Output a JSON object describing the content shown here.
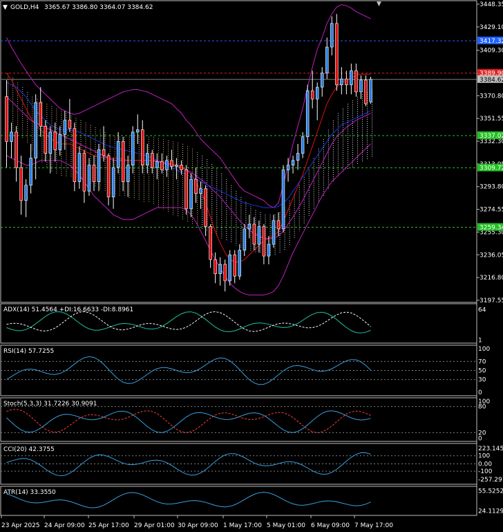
{
  "colors": {
    "background": "#000000",
    "frame": "#c0c0c0",
    "bull": "#2a7de1",
    "bear": "#e01010",
    "bb": "#c020c0",
    "ma_red": "#e01010",
    "ma_blue": "#1a35d8",
    "chikou": "#28c828",
    "kumo_bull": "#d8c090",
    "kumo_bear": "#e8e8e8",
    "level_green": "#22c022",
    "level_red": "#e02020",
    "level_blue": "#2060ff",
    "indicator_line": "#3aa0e0",
    "indicator_signal": "#ff4040",
    "adx_plus": "#20c0a0"
  },
  "header": {
    "symbol_label": "GOLD,H4",
    "ohlc": "3365.67 3386.80 3364.07 3384.62",
    "arrow_icon": "triangle-down-icon"
  },
  "price_axis": {
    "ticks": [
      "3448.35",
      "3429.10",
      "3409.30",
      "3389.61",
      "3370.80",
      "3351.55",
      "3332.30",
      "3313.05",
      "3293.80",
      "3274.55",
      "3255.30",
      "3236.05",
      "3216.80",
      "3197.55"
    ],
    "tags": [
      {
        "text": "3417.32",
        "color": "#2060ff",
        "value": 3417.32
      },
      {
        "text": "3389.90",
        "color": "#e02020",
        "value": 3389.9
      },
      {
        "text": "3384.62",
        "color": "#c0c0c0",
        "value": 3384.62
      },
      {
        "text": "3337.02",
        "color": "#22c022",
        "value": 3337.02
      },
      {
        "text": "3309.72",
        "color": "#22c022",
        "value": 3309.72
      },
      {
        "text": "3259.34",
        "color": "#22c022",
        "value": 3259.34
      }
    ]
  },
  "time_axis": [
    "23 Apr 2025",
    "24 Apr 09:00",
    "25 Apr 17:00",
    "29 Apr 01:00",
    "30 Apr 09:00",
    "1 May 17:00",
    "5 May 01:00",
    "6 May 09:00",
    "7 May 17:00"
  ],
  "panels": {
    "adx": {
      "label": "ADX(14) 51.4564 +DI:16.6633 -DI:8.8961",
      "ticks": [
        "64",
        "1"
      ]
    },
    "rsi": {
      "label": "RSI(14) 57.7255",
      "ticks": [
        "100",
        "70",
        "50",
        "30",
        "0"
      ]
    },
    "stoch": {
      "label": "Stoch(5,3,3) 31.7226 30.9091",
      "ticks": [
        "100",
        "80",
        "20",
        "0"
      ]
    },
    "cci": {
      "label": "CCI(20) 42.3755",
      "ticks": [
        "223.1458",
        "100",
        "0.00",
        "-100",
        "-257.297"
      ]
    },
    "atr": {
      "label": "ATR(14) 33.3550",
      "ticks": [
        "55.5252",
        "24.1129"
      ]
    }
  },
  "chart_data": {
    "type": "candlestick",
    "symbol": "GOLD",
    "timeframe": "H4",
    "ylim": [
      3197.55,
      3448.35
    ],
    "candles": [
      [
        3370,
        3384,
        3310,
        3332
      ],
      [
        3332,
        3348,
        3318,
        3340
      ],
      [
        3340,
        3345,
        3298,
        3310
      ],
      [
        3310,
        3320,
        3270,
        3282
      ],
      [
        3282,
        3300,
        3268,
        3295
      ],
      [
        3295,
        3330,
        3288,
        3318
      ],
      [
        3318,
        3372,
        3300,
        3365
      ],
      [
        3365,
        3378,
        3336,
        3345
      ],
      [
        3345,
        3350,
        3315,
        3322
      ],
      [
        3322,
        3345,
        3305,
        3340
      ],
      [
        3340,
        3348,
        3315,
        3325
      ],
      [
        3325,
        3345,
        3320,
        3338
      ],
      [
        3338,
        3358,
        3325,
        3350
      ],
      [
        3350,
        3368,
        3340,
        3343
      ],
      [
        3343,
        3348,
        3290,
        3298
      ],
      [
        3298,
        3328,
        3292,
        3322
      ],
      [
        3322,
        3325,
        3280,
        3290
      ],
      [
        3290,
        3318,
        3286,
        3312
      ],
      [
        3312,
        3320,
        3290,
        3298
      ],
      [
        3298,
        3330,
        3290,
        3325
      ],
      [
        3325,
        3345,
        3315,
        3320
      ],
      [
        3320,
        3322,
        3278,
        3285
      ],
      [
        3285,
        3318,
        3275,
        3310
      ],
      [
        3310,
        3340,
        3305,
        3332
      ],
      [
        3332,
        3336,
        3290,
        3298
      ],
      [
        3298,
        3320,
        3285,
        3312
      ],
      [
        3312,
        3345,
        3305,
        3340
      ],
      [
        3340,
        3355,
        3330,
        3342
      ],
      [
        3342,
        3350,
        3305,
        3312
      ],
      [
        3312,
        3330,
        3305,
        3322
      ],
      [
        3322,
        3325,
        3305,
        3310
      ],
      [
        3310,
        3322,
        3300,
        3315
      ],
      [
        3315,
        3322,
        3305,
        3308
      ],
      [
        3308,
        3320,
        3302,
        3316
      ],
      [
        3316,
        3325,
        3308,
        3311
      ],
      [
        3311,
        3318,
        3300,
        3312
      ],
      [
        3312,
        3316,
        3304,
        3308
      ],
      [
        3308,
        3312,
        3270,
        3275
      ],
      [
        3275,
        3305,
        3268,
        3300
      ],
      [
        3300,
        3310,
        3280,
        3288
      ],
      [
        3288,
        3298,
        3275,
        3292
      ],
      [
        3292,
        3295,
        3252,
        3260
      ],
      [
        3260,
        3262,
        3225,
        3232
      ],
      [
        3232,
        3238,
        3212,
        3220
      ],
      [
        3220,
        3234,
        3210,
        3228
      ],
      [
        3228,
        3232,
        3205,
        3214
      ],
      [
        3214,
        3240,
        3210,
        3236
      ],
      [
        3236,
        3240,
        3212,
        3218
      ],
      [
        3218,
        3245,
        3215,
        3240
      ],
      [
        3240,
        3262,
        3235,
        3258
      ],
      [
        3258,
        3270,
        3250,
        3262
      ],
      [
        3262,
        3268,
        3240,
        3245
      ],
      [
        3245,
        3265,
        3238,
        3260
      ],
      [
        3260,
        3262,
        3228,
        3235
      ],
      [
        3235,
        3252,
        3228,
        3245
      ],
      [
        3245,
        3270,
        3242,
        3265
      ],
      [
        3265,
        3272,
        3252,
        3258
      ],
      [
        3258,
        3312,
        3255,
        3308
      ],
      [
        3308,
        3318,
        3298,
        3312
      ],
      [
        3312,
        3320,
        3305,
        3316
      ],
      [
        3316,
        3330,
        3308,
        3322
      ],
      [
        3322,
        3340,
        3318,
        3336
      ],
      [
        3336,
        3380,
        3330,
        3375
      ],
      [
        3375,
        3392,
        3360,
        3368
      ],
      [
        3368,
        3382,
        3350,
        3378
      ],
      [
        3378,
        3395,
        3370,
        3390
      ],
      [
        3390,
        3420,
        3385,
        3412
      ],
      [
        3412,
        3438,
        3405,
        3432
      ],
      [
        3432,
        3440,
        3375,
        3380
      ],
      [
        3380,
        3395,
        3372,
        3385
      ],
      [
        3385,
        3392,
        3372,
        3380
      ],
      [
        3380,
        3398,
        3372,
        3392
      ],
      [
        3392,
        3398,
        3370,
        3374
      ],
      [
        3374,
        3388,
        3368,
        3384
      ],
      [
        3384,
        3388,
        3362,
        3364
      ],
      [
        3365.67,
        3386.8,
        3364.07,
        3384.62
      ]
    ],
    "overlays": {
      "bollinger_upper": [
        3420,
        3412,
        3405,
        3398,
        3392,
        3386,
        3380,
        3376,
        3372,
        3368,
        3364,
        3360,
        3358,
        3356,
        3355,
        3356,
        3358,
        3360,
        3362,
        3364,
        3366,
        3368,
        3370,
        3372,
        3374,
        3375,
        3376,
        3376,
        3375,
        3374,
        3372,
        3370,
        3368,
        3366,
        3364,
        3360,
        3356,
        3350,
        3346,
        3340,
        3334,
        3330,
        3326,
        3322,
        3318,
        3312,
        3306,
        3300,
        3294,
        3290,
        3288,
        3286,
        3284,
        3282,
        3278,
        3276,
        3280,
        3295,
        3312,
        3330,
        3345,
        3360,
        3378,
        3395,
        3410,
        3420,
        3432,
        3440,
        3446,
        3448,
        3447,
        3445,
        3442,
        3440,
        3438,
        3436
      ],
      "bollinger_middle": [
        3370,
        3366,
        3362,
        3358,
        3354,
        3350,
        3348,
        3346,
        3344,
        3342,
        3340,
        3338,
        3336,
        3334,
        3332,
        3330,
        3328,
        3326,
        3324,
        3322,
        3320,
        3318,
        3316,
        3316,
        3316,
        3316,
        3316,
        3316,
        3316,
        3316,
        3316,
        3315,
        3314,
        3313,
        3312,
        3311,
        3310,
        3308,
        3306,
        3303,
        3300,
        3297,
        3293,
        3289,
        3285,
        3280,
        3275,
        3270,
        3265,
        3261,
        3257,
        3254,
        3252,
        3250,
        3250,
        3250,
        3252,
        3256,
        3262,
        3268,
        3275,
        3282,
        3290,
        3298,
        3306,
        3314,
        3322,
        3330,
        3336,
        3340,
        3344,
        3347,
        3350,
        3352,
        3354,
        3356
      ],
      "bollinger_lower": [
        3320,
        3318,
        3316,
        3314,
        3312,
        3312,
        3314,
        3316,
        3316,
        3316,
        3316,
        3316,
        3314,
        3312,
        3308,
        3304,
        3298,
        3292,
        3286,
        3282,
        3278,
        3274,
        3270,
        3268,
        3266,
        3266,
        3266,
        3268,
        3270,
        3272,
        3274,
        3276,
        3276,
        3276,
        3276,
        3276,
        3276,
        3274,
        3270,
        3264,
        3256,
        3248,
        3240,
        3232,
        3225,
        3218,
        3212,
        3208,
        3205,
        3203,
        3202,
        3202,
        3202,
        3202,
        3203,
        3205,
        3210,
        3218,
        3228,
        3238,
        3246,
        3254,
        3262,
        3270,
        3278,
        3286,
        3292,
        3298,
        3302,
        3306,
        3310,
        3314,
        3318,
        3322,
        3326,
        3330
      ],
      "ma_red": [
        3390,
        3384,
        3376,
        3368,
        3360,
        3352,
        3346,
        3342,
        3338,
        3335,
        3332,
        3330,
        3330,
        3330,
        3328,
        3326,
        3324,
        3322,
        3320,
        3319,
        3318,
        3318,
        3318,
        3318,
        3317,
        3316,
        3316,
        3316,
        3316,
        3316,
        3316,
        3316,
        3315,
        3314,
        3313,
        3312,
        3311,
        3308,
        3304,
        3298,
        3290,
        3280,
        3268,
        3256,
        3246,
        3238,
        3232,
        3230,
        3230,
        3232,
        3236,
        3240,
        3244,
        3248,
        3250,
        3252,
        3256,
        3264,
        3274,
        3284,
        3294,
        3304,
        3316,
        3328,
        3340,
        3352,
        3364,
        3372,
        3378,
        3382,
        3384,
        3386,
        3388,
        3389,
        3389,
        3389
      ],
      "ma_blue": [
        3382,
        3380,
        3378,
        3374,
        3370,
        3364,
        3358,
        3354,
        3350,
        3346,
        3344,
        3342,
        3342,
        3342,
        3341,
        3340,
        3338,
        3336,
        3334,
        3332,
        3330,
        3328,
        3327,
        3326,
        3325,
        3324,
        3323,
        3322,
        3321,
        3320,
        3318,
        3316,
        3314,
        3312,
        3310,
        3308,
        3306,
        3304,
        3302,
        3300,
        3298,
        3296,
        3294,
        3292,
        3290,
        3288,
        3286,
        3284,
        3282,
        3280,
        3279,
        3278,
        3277,
        3276,
        3276,
        3276,
        3277,
        3280,
        3284,
        3290,
        3296,
        3302,
        3308,
        3314,
        3320,
        3326,
        3332,
        3338,
        3342,
        3346,
        3348,
        3350,
        3352,
        3354,
        3356,
        3358
      ]
    }
  }
}
